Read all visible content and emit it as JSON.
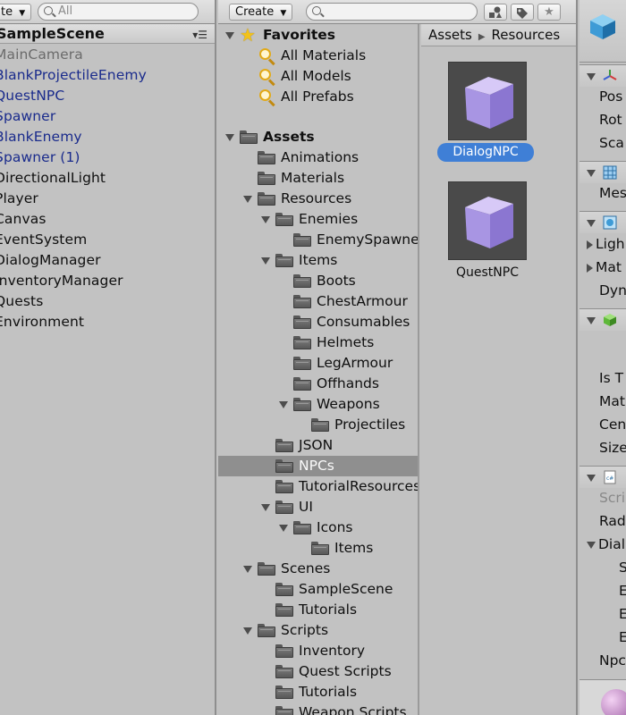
{
  "hierarchy": {
    "create_label": "ate",
    "search_placeholder": "All",
    "scene_name": "SampleScene",
    "items": [
      {
        "label": "MainCamera",
        "kind": "inactive"
      },
      {
        "label": "BlankProjectileEnemy",
        "kind": "prefab"
      },
      {
        "label": "QuestNPC",
        "kind": "prefab"
      },
      {
        "label": "Spawner",
        "kind": "prefab"
      },
      {
        "label": "BlankEnemy",
        "kind": "prefab"
      },
      {
        "label": "Spawner (1)",
        "kind": "prefab"
      },
      {
        "label": "DirectionalLight",
        "kind": "normal"
      },
      {
        "label": "Player",
        "kind": "normal"
      },
      {
        "label": "Canvas",
        "kind": "normal"
      },
      {
        "label": "EventSystem",
        "kind": "normal"
      },
      {
        "label": "DialogManager",
        "kind": "normal"
      },
      {
        "label": "InventoryManager",
        "kind": "normal"
      },
      {
        "label": "Quests",
        "kind": "normal"
      },
      {
        "label": "Environment",
        "kind": "normal"
      }
    ]
  },
  "project": {
    "create_label": "Create",
    "breadcrumb": [
      "Assets",
      "Resources"
    ],
    "favorites_label": "Favorites",
    "favorites": [
      "All Materials",
      "All Models",
      "All Prefabs"
    ],
    "assets_label": "Assets",
    "tree": [
      {
        "label": "Animations",
        "indent": 1,
        "expanded": false
      },
      {
        "label": "Materials",
        "indent": 1,
        "expanded": false
      },
      {
        "label": "Resources",
        "indent": 1,
        "expanded": true
      },
      {
        "label": "Enemies",
        "indent": 2,
        "expanded": true
      },
      {
        "label": "EnemySpawner",
        "indent": 3,
        "expanded": false
      },
      {
        "label": "Items",
        "indent": 2,
        "expanded": true
      },
      {
        "label": "Boots",
        "indent": 3,
        "expanded": false
      },
      {
        "label": "ChestArmour",
        "indent": 3,
        "expanded": false
      },
      {
        "label": "Consumables",
        "indent": 3,
        "expanded": false
      },
      {
        "label": "Helmets",
        "indent": 3,
        "expanded": false
      },
      {
        "label": "LegArmour",
        "indent": 3,
        "expanded": false
      },
      {
        "label": "Offhands",
        "indent": 3,
        "expanded": false
      },
      {
        "label": "Weapons",
        "indent": 3,
        "expanded": true
      },
      {
        "label": "Projectiles",
        "indent": 4,
        "expanded": false
      },
      {
        "label": "JSON",
        "indent": 2,
        "expanded": false
      },
      {
        "label": "NPCs",
        "indent": 2,
        "expanded": false,
        "selected": true
      },
      {
        "label": "TutorialResources",
        "indent": 2,
        "expanded": false
      },
      {
        "label": "UI",
        "indent": 2,
        "expanded": true
      },
      {
        "label": "Icons",
        "indent": 3,
        "expanded": true
      },
      {
        "label": "Items",
        "indent": 4,
        "expanded": false
      },
      {
        "label": "Scenes",
        "indent": 1,
        "expanded": true
      },
      {
        "label": "SampleScene",
        "indent": 2,
        "expanded": false
      },
      {
        "label": "Tutorials",
        "indent": 2,
        "expanded": false
      },
      {
        "label": "Scripts",
        "indent": 1,
        "expanded": true
      },
      {
        "label": "Inventory",
        "indent": 2,
        "expanded": false
      },
      {
        "label": "Quest Scripts",
        "indent": 2,
        "expanded": false
      },
      {
        "label": "Tutorials",
        "indent": 2,
        "expanded": false
      },
      {
        "label": "Weapon Scripts",
        "indent": 2,
        "expanded": false
      }
    ],
    "assets": [
      {
        "name": "DialogNPC",
        "selected": true
      },
      {
        "name": "QuestNPC",
        "selected": false
      }
    ]
  },
  "inspector": {
    "transform_props": [
      "Pos",
      "Rot",
      "Sca"
    ],
    "mesh_prop": "Mes",
    "renderer_props": [
      "Ligh",
      "Mat",
      "Dyn"
    ],
    "collider_props": [
      "Is T",
      "Mat",
      "Cen",
      "Size"
    ],
    "script_props": [
      "Scri",
      "Rad",
      "Dial"
    ],
    "dialog_subprops": [
      "S",
      "E",
      "E",
      "E"
    ],
    "last_prop": "Npc"
  }
}
